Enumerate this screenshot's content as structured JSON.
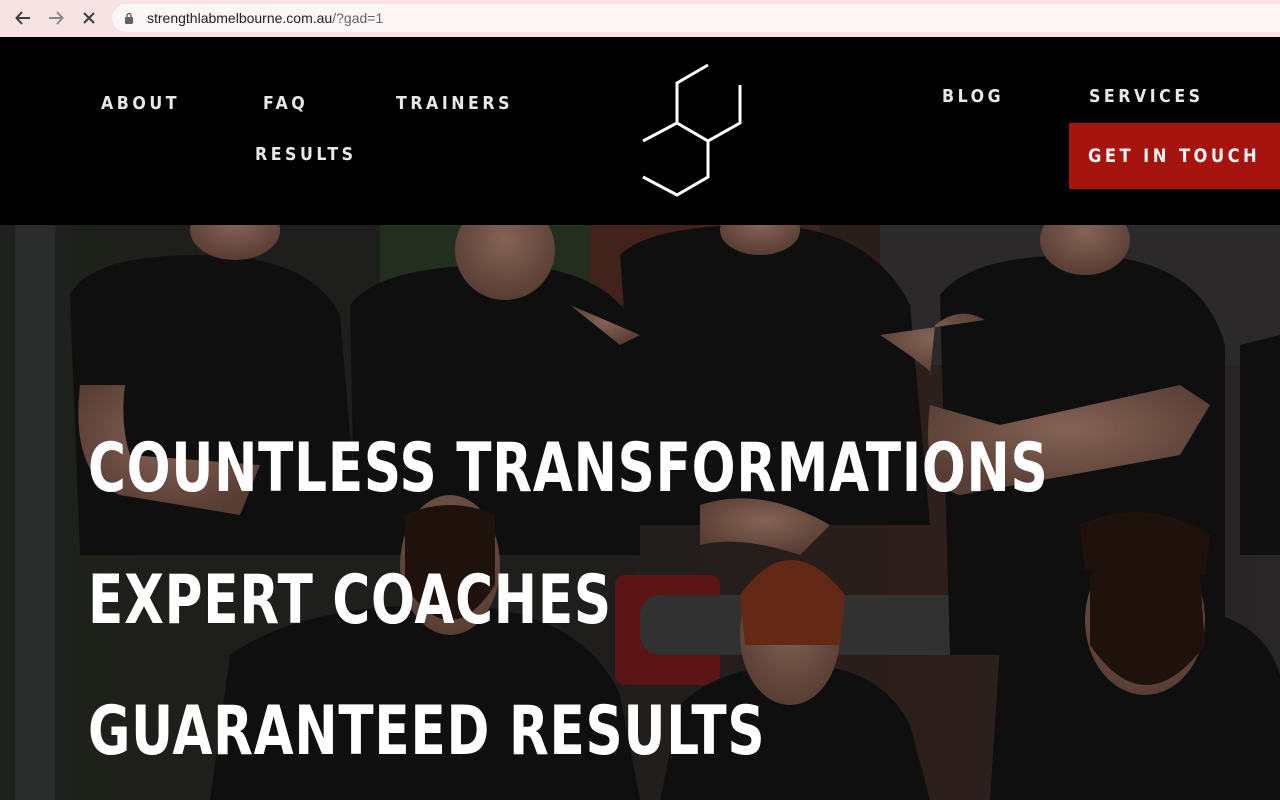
{
  "browser": {
    "url_host": "strengthlabmelbourne.com.au",
    "url_path": "/?gad=1",
    "icons": [
      "back-arrow-icon",
      "forward-arrow-icon",
      "stop-loading-icon",
      "lock-icon"
    ]
  },
  "header": {
    "nav_left": {
      "about": "ABOUT",
      "faq": "FAQ",
      "trainers": "TRAINERS",
      "results": "RESULTS"
    },
    "nav_right": {
      "blog": "BLOG",
      "services": "SERVICES"
    },
    "cta_label": "GET IN TOUCH",
    "logo_icon": "hexagon-logo-icon"
  },
  "hero": {
    "lines": [
      "COUNTLESS TRANSFORMATIONS",
      "EXPERT COACHES",
      "GUARANTEED RESULTS"
    ]
  },
  "colors": {
    "header_bg": "#000000",
    "cta_bg": "#a5140f",
    "nav_text": "#e8e8e8",
    "browser_bar": "#f7e3e3"
  }
}
